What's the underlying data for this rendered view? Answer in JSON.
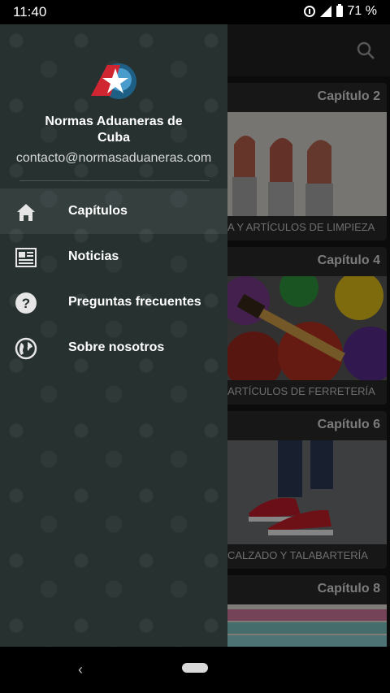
{
  "status_bar": {
    "time": "11:40",
    "battery": "71 %"
  },
  "drawer": {
    "title": "Normas Aduaneras de Cuba",
    "email": "contacto@normasaduaneras.com",
    "items": [
      {
        "label": "Capítulos",
        "icon": "home-icon",
        "active": true
      },
      {
        "label": "Noticias",
        "icon": "newspaper-icon"
      },
      {
        "label": "Preguntas frecuentes",
        "icon": "help-icon"
      },
      {
        "label": "Sobre nosotros",
        "icon": "globe-icon"
      }
    ]
  },
  "cards": [
    {
      "chapter": "Capítulo 2",
      "caption": "A Y ARTÍCULOS DE LIMPIEZA"
    },
    {
      "chapter": "Capítulo 4",
      "caption": "ARTÍCULOS DE FERRETERÍA"
    },
    {
      "chapter": "Capítulo 6",
      "caption": "CALZADO Y TALABARTERÍA"
    },
    {
      "chapter": "Capítulo 8",
      "caption": ""
    }
  ]
}
